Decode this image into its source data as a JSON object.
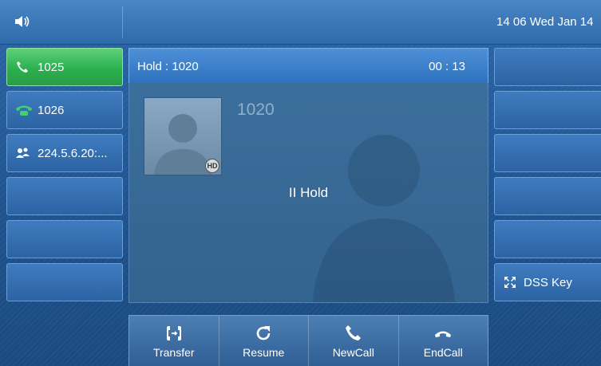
{
  "status_bar": {
    "volume_icon": "speaker-icon",
    "clock": "14 06 Wed Jan 14"
  },
  "line_keys": [
    {
      "label": "1025",
      "icon": "phone-green-icon",
      "active": true
    },
    {
      "label": "1026",
      "icon": "phone-handset-icon",
      "active": false
    },
    {
      "label": "224.5.6.20:...",
      "icon": "multicast-users-icon",
      "active": false
    },
    {
      "label": "",
      "active": false
    },
    {
      "label": "",
      "active": false
    },
    {
      "label": "",
      "active": false
    }
  ],
  "call": {
    "header_label": "Hold : 1020",
    "timer": "00 : 13",
    "caller_number": "1020",
    "status": "II Hold",
    "hd_badge": "HD"
  },
  "right_keys": [
    {
      "label": ""
    },
    {
      "label": ""
    },
    {
      "label": ""
    },
    {
      "label": ""
    },
    {
      "label": ""
    },
    {
      "label": "DSS Key",
      "icon": "expand-arrows-icon"
    }
  ],
  "softkeys": [
    {
      "label": "Transfer",
      "icon": "transfer-icon"
    },
    {
      "label": "Resume",
      "icon": "refresh-icon"
    },
    {
      "label": "NewCall",
      "icon": "phone-icon"
    },
    {
      "label": "EndCall",
      "icon": "hangup-icon"
    }
  ],
  "colors": {
    "active_line": "#2bb04f",
    "background": "#1d4f86",
    "header": "#2f72bd"
  }
}
